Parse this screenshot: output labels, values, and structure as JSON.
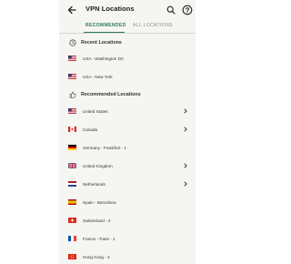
{
  "app": {
    "title": "VPN Locations",
    "icons": {
      "back": "arrow-left-icon",
      "search": "search-icon",
      "help": "help-icon"
    }
  },
  "colors": {
    "accent": "#2c7a5c",
    "background": "#f5f5f2",
    "text": "#222222"
  },
  "tabs": [
    {
      "label": "RECOMMENDED",
      "selected": true
    },
    {
      "label": "ALL LOCATIONS",
      "selected": false
    }
  ],
  "recent": {
    "title": "Recent Locations",
    "icon": "clock-icon",
    "items": [
      {
        "label": "USA - Washington DC",
        "flag": "us",
        "has_chevron": false
      },
      {
        "label": "USA - New York",
        "flag": "us",
        "has_chevron": false
      }
    ]
  },
  "recommended": {
    "title": "Recommended Locations",
    "icon": "thumbs-up-icon",
    "items": [
      {
        "label": "United States",
        "flag": "us",
        "has_chevron": true
      },
      {
        "label": "Canada",
        "flag": "ca",
        "has_chevron": true
      },
      {
        "label": "Germany - Frankfurt - 1",
        "flag": "de",
        "has_chevron": false
      },
      {
        "label": "United Kingdom",
        "flag": "uk",
        "has_chevron": true
      },
      {
        "label": "Netherlands",
        "flag": "nl",
        "has_chevron": true
      },
      {
        "label": "Spain - Barcelona",
        "flag": "es",
        "has_chevron": false
      },
      {
        "label": "Switzerland - 2",
        "flag": "ch",
        "has_chevron": false
      },
      {
        "label": "France - Paris - 1",
        "flag": "fr",
        "has_chevron": false
      },
      {
        "label": "Hong Kong - 2",
        "flag": "hk",
        "has_chevron": false
      }
    ]
  }
}
